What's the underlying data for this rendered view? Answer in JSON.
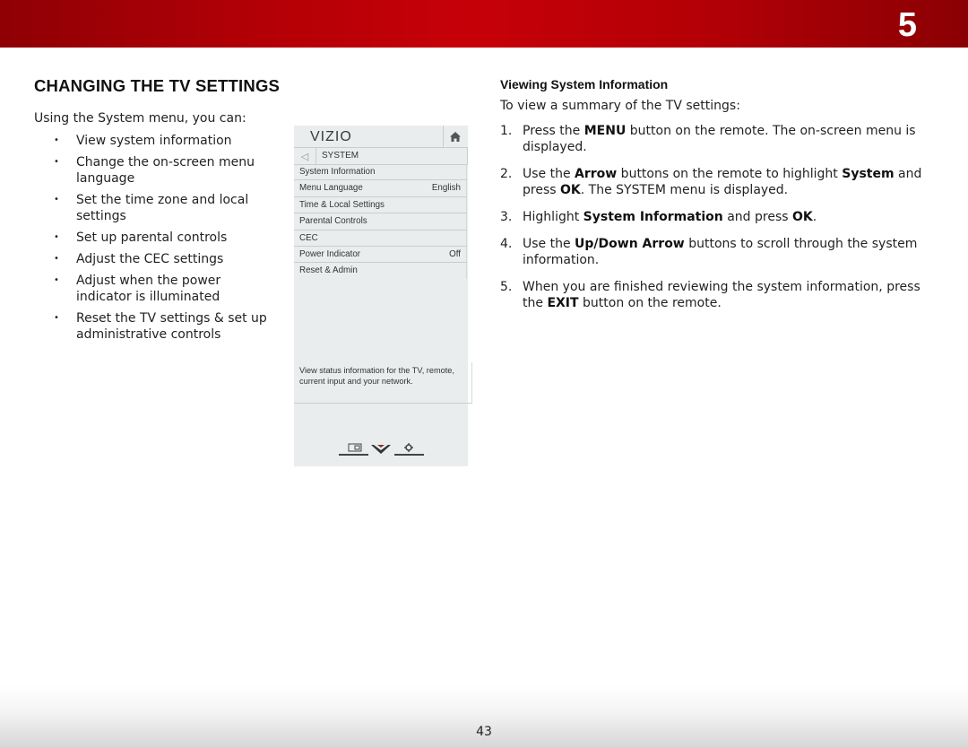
{
  "header": {
    "chapter_number": "5",
    "colors": {
      "bar_center": "#c70008",
      "bar_edge": "#8a0004"
    }
  },
  "left": {
    "title": "CHANGING THE TV SETTINGS",
    "intro": "Using the System menu, you can:",
    "bullet_glyph": "•",
    "bullets": [
      "View system information",
      "Change the on-screen menu language",
      "Set the time zone and local settings",
      "Set up parental controls",
      "Adjust the CEC settings",
      "Adjust when the power indicator is illuminated",
      "Reset the TV settings & set up administrative controls"
    ]
  },
  "tv_menu": {
    "logo": "VIZIO",
    "home_icon": "home-icon",
    "back_icon": "back-arrow-icon",
    "back_glyph": "◁",
    "section_title": "SYSTEM",
    "items": [
      {
        "label": "System Information",
        "value": ""
      },
      {
        "label": "Menu Language",
        "value": "English"
      },
      {
        "label": "Time & Local Settings",
        "value": ""
      },
      {
        "label": "Parental Controls",
        "value": ""
      },
      {
        "label": "CEC",
        "value": ""
      },
      {
        "label": "Power Indicator",
        "value": "Off"
      },
      {
        "label": "Reset & Admin",
        "value": ""
      }
    ],
    "description": "View status information for the TV, remote, current input and your network.",
    "bottom_icons": [
      "wide-mode-icon",
      "vizio-v-icon",
      "settings-gear-icon"
    ]
  },
  "right": {
    "subheading": "Viewing System Information",
    "lead": "To view a summary of the TV settings:",
    "steps": [
      {
        "num": "1.",
        "parts": [
          [
            "Press the ",
            false
          ],
          [
            "MENU",
            true
          ],
          [
            " button on the remote. The on-screen menu is displayed.",
            false
          ]
        ]
      },
      {
        "num": "2.",
        "parts": [
          [
            "Use the ",
            false
          ],
          [
            "Arrow",
            true
          ],
          [
            " buttons on the remote to highlight ",
            false
          ],
          [
            "System",
            true
          ],
          [
            " and press ",
            false
          ],
          [
            "OK",
            true
          ],
          [
            ". The SYSTEM menu is displayed.",
            false
          ]
        ]
      },
      {
        "num": "3.",
        "parts": [
          [
            "Highlight ",
            false
          ],
          [
            "System Information",
            true
          ],
          [
            " and press ",
            false
          ],
          [
            "OK",
            true
          ],
          [
            ".",
            false
          ]
        ]
      },
      {
        "num": "4.",
        "parts": [
          [
            "Use the ",
            false
          ],
          [
            "Up/Down Arrow",
            true
          ],
          [
            " buttons to scroll through the system information.",
            false
          ]
        ]
      },
      {
        "num": "5.",
        "parts": [
          [
            "When you are finished reviewing the system information, press the ",
            false
          ],
          [
            "EXIT",
            true
          ],
          [
            " button on the remote.",
            false
          ]
        ]
      }
    ]
  },
  "footer": {
    "page_number": "43"
  }
}
